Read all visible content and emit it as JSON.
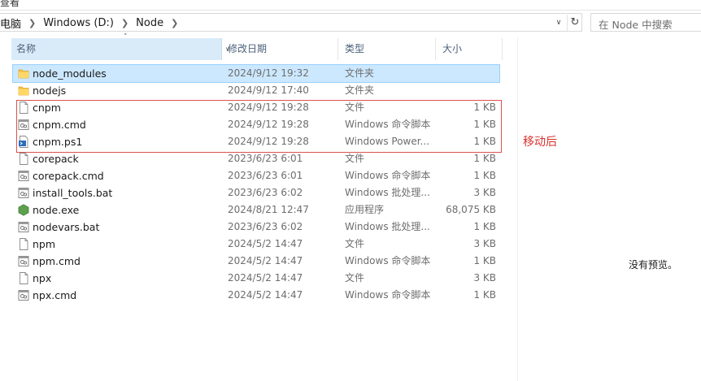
{
  "window": {
    "top_menu_partial": "查看"
  },
  "address": {
    "crumbs": [
      "此电脑",
      "Windows (D:)",
      "Node"
    ],
    "visible_crumb_0": "电脑"
  },
  "search": {
    "placeholder": "在 Node 中搜索"
  },
  "columns": {
    "name": "名称",
    "date": "修改日期",
    "type": "类型",
    "size": "大小"
  },
  "files": [
    {
      "name": "node_modules",
      "date": "2024/9/12 19:32",
      "type": "文件夹",
      "size": "",
      "icon": "folder-icon",
      "selected": true
    },
    {
      "name": "nodejs",
      "date": "2024/9/12 17:40",
      "type": "文件夹",
      "size": "",
      "icon": "folder-icon"
    },
    {
      "name": "cnpm",
      "date": "2024/9/12 19:28",
      "type": "文件",
      "size": "1 KB",
      "icon": "file-icon"
    },
    {
      "name": "cnpm.cmd",
      "date": "2024/9/12 19:28",
      "type": "Windows 命令脚本",
      "size": "1 KB",
      "icon": "cmd-file-icon"
    },
    {
      "name": "cnpm.ps1",
      "date": "2024/9/12 19:28",
      "type": "Windows Power...",
      "size": "1 KB",
      "icon": "powershell-file-icon"
    },
    {
      "name": "corepack",
      "date": "2023/6/23 6:01",
      "type": "文件",
      "size": "1 KB",
      "icon": "file-icon"
    },
    {
      "name": "corepack.cmd",
      "date": "2023/6/23 6:01",
      "type": "Windows 命令脚本",
      "size": "1 KB",
      "icon": "cmd-file-icon"
    },
    {
      "name": "install_tools.bat",
      "date": "2023/6/23 6:02",
      "type": "Windows 批处理...",
      "size": "3 KB",
      "icon": "bat-file-icon"
    },
    {
      "name": "node.exe",
      "date": "2024/8/21 12:47",
      "type": "应用程序",
      "size": "68,075 KB",
      "icon": "node-exe-icon"
    },
    {
      "name": "nodevars.bat",
      "date": "2023/6/23 6:02",
      "type": "Windows 批处理...",
      "size": "1 KB",
      "icon": "bat-file-icon"
    },
    {
      "name": "npm",
      "date": "2024/5/2 14:47",
      "type": "文件",
      "size": "3 KB",
      "icon": "file-icon"
    },
    {
      "name": "npm.cmd",
      "date": "2024/5/2 14:47",
      "type": "Windows 命令脚本",
      "size": "1 KB",
      "icon": "cmd-file-icon"
    },
    {
      "name": "npx",
      "date": "2024/5/2 14:47",
      "type": "文件",
      "size": "3 KB",
      "icon": "file-icon"
    },
    {
      "name": "npx.cmd",
      "date": "2024/5/2 14:47",
      "type": "Windows 命令脚本",
      "size": "1 KB",
      "icon": "cmd-file-icon"
    }
  ],
  "annotation": {
    "text": "移动后",
    "color": "#d9302c"
  },
  "preview_pane": {
    "text": "没有预览。"
  },
  "colors": {
    "selection": "#cce8ff",
    "header_highlight": "#d9ebf9",
    "folder": "#f5c242",
    "node_green": "#5fa04e"
  }
}
